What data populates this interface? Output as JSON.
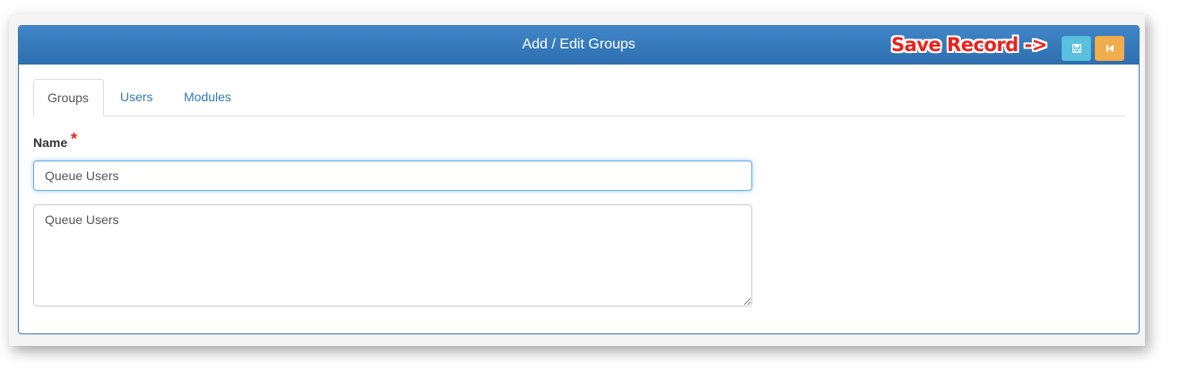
{
  "panel": {
    "title": "Add / Edit Groups",
    "annotation": "Save Record ->",
    "buttons": {
      "save_icon": "save-icon",
      "back_icon": "step-backward-icon",
      "save_color": "#5bc0de",
      "back_color": "#f0ad4e"
    }
  },
  "tabs": [
    {
      "label": "Groups",
      "active": true
    },
    {
      "label": "Users",
      "active": false
    },
    {
      "label": "Modules",
      "active": false
    }
  ],
  "form": {
    "name_label": "Name",
    "required_marker": "*",
    "name_value": "Queue Users",
    "description_value": "Queue Users"
  },
  "colors": {
    "header": "#2e6eae",
    "link": "#337ab7",
    "required": "#e8231c"
  }
}
